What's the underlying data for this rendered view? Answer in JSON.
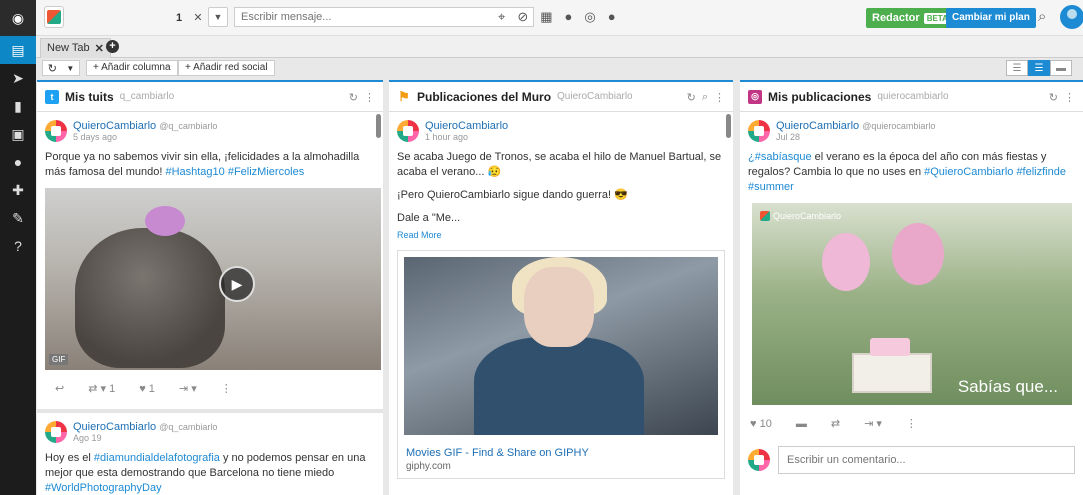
{
  "topbar": {
    "count": "1",
    "message_placeholder": "Escribir mensaje...",
    "redactor_label": "Redactor",
    "beta_label": "BETA",
    "plan_label": "Cambiar mi plan"
  },
  "tabs": [
    {
      "label": "New Tab"
    }
  ],
  "toolbar": {
    "add_column": "+ Añadir columna",
    "add_network": "+ Añadir red social"
  },
  "columns": [
    {
      "network": "twitter",
      "title": "Mis tuits",
      "subtitle": "q_cambiarlo",
      "posts": [
        {
          "name": "QuieroCambiarlo",
          "handle": "@q_cambiarlo",
          "time": "5 days ago",
          "text_pre": "Porque ya no sabemos vivir sin ella, ¡felicidades a la almohadilla más famosa del mundo! ",
          "tags": "#Hashtag10 #FelizMiercoles",
          "media_label": "GIF",
          "retweets": "1",
          "likes": "1"
        },
        {
          "name": "QuieroCambiarlo",
          "handle": "@q_cambiarlo",
          "time": "Ago 19",
          "text_a": "Hoy es el ",
          "tag_a": "#diamundialdelafotografia",
          "text_b": " y no podemos pensar en una mejor que esta demostrando que Barcelona no tiene miedo ",
          "tag_b": "#WorldPhotographyDay"
        }
      ]
    },
    {
      "network": "facebook",
      "title": "Publicaciones del Muro",
      "subtitle": "QuieroCambiarlo",
      "posts": [
        {
          "name": "QuieroCambiarlo",
          "time": "1 hour ago",
          "text_1": "Se acaba Juego de Tronos, se acaba el hilo de Manuel Bartual, se acaba el verano... 😥",
          "text_2": "¡Pero QuieroCambiarlo sigue dando guerra! 😎",
          "text_3": "Dale a \"Me...",
          "read_more": "Read More",
          "link_title": "Movies GIF - Find & Share on GIPHY",
          "link_domain": "giphy.com"
        }
      ]
    },
    {
      "network": "instagram",
      "title": "Mis publicaciones",
      "subtitle": "quierocambiarlo",
      "posts": [
        {
          "name": "QuieroCambiarlo",
          "handle": "@quierocambiarlo",
          "time": "Jul 28",
          "tag_a": "¿#sabíasque",
          "text_a": " el verano es la época del año con más fiestas y regalos? Cambia lo que no uses en ",
          "tags": "#QuieroCambiarlo #felizfinde #summer",
          "image_caption": "Sabías que...",
          "image_logo": "QuieroCambiarlo",
          "likes": "10",
          "comment_placeholder": "Escribir un comentario..."
        }
      ]
    }
  ]
}
